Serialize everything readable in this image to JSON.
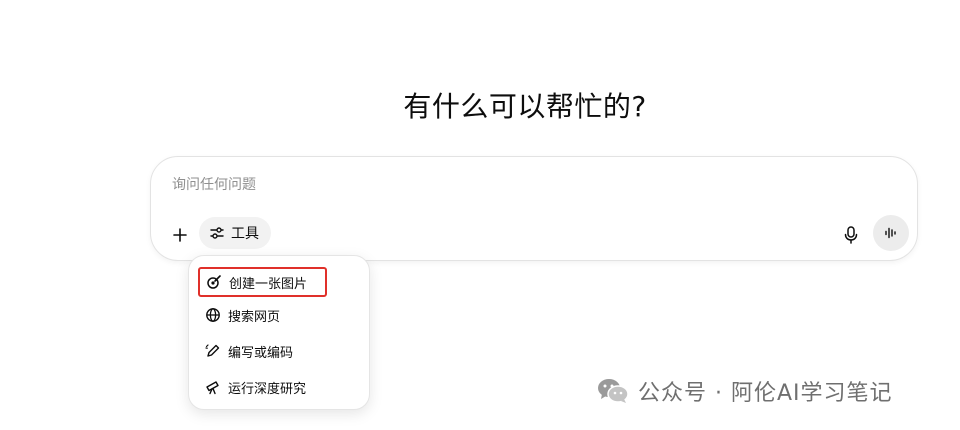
{
  "header": {
    "title": "有什么可以帮忙的?"
  },
  "composer": {
    "placeholder": "询问任何问题",
    "value": "",
    "tools_label": "工具",
    "icons": {
      "plus": "plus-icon",
      "tools": "sliders-icon",
      "mic": "microphone-icon",
      "voice": "voice-waveform-icon"
    }
  },
  "tools_menu": {
    "items": [
      {
        "label": "创建一张图片",
        "icon": "image-create-icon",
        "highlighted": true
      },
      {
        "label": "搜索网页",
        "icon": "globe-icon",
        "highlighted": false
      },
      {
        "label": "编写或编码",
        "icon": "pen-icon",
        "highlighted": false
      },
      {
        "label": "运行深度研究",
        "icon": "telescope-icon",
        "highlighted": false
      }
    ]
  },
  "watermark": {
    "text": "公众号 · 阿伦AI学习笔记",
    "icon": "wechat-icon"
  },
  "colors": {
    "highlight_border": "#e0302a",
    "text": "#0d0d0d",
    "placeholder": "#8f8f8f",
    "watermark": "#6f6f6f"
  }
}
